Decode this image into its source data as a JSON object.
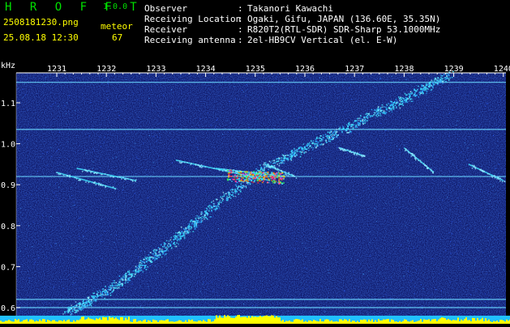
{
  "app": {
    "name": "H R O F F T",
    "version": "1.0.0"
  },
  "file": {
    "name": "2508181230.png",
    "datetime": "25.08.18 12:30",
    "meteor_label": "meteor",
    "meteor_count": "67"
  },
  "meta": [
    {
      "label": "Observer",
      "value": "Takanori Kawachi"
    },
    {
      "label": "Receiving Location",
      "value": "Ogaki, Gifu, JAPAN (136.60E, 35.35N)"
    },
    {
      "label": "Receiver",
      "value": "R820T2(RTL-SDR) SDR-Sharp 53.1000MHz"
    },
    {
      "label": "Receiving antenna",
      "value": "2el-HB9CV Vertical (el. E-W)"
    }
  ],
  "colors": {
    "background": "#000000",
    "plot_bg": "#101a6a",
    "title_green": "#00e000",
    "file_yellow": "#ffff00",
    "tick_yellow": "#ffff00",
    "echo_cyan": "#40e0ff",
    "echo_hot": "#ff40c0",
    "noise_bar": "#ffff00",
    "baseline": "#20c0ff"
  },
  "chart_data": {
    "type": "heatmap",
    "y_unit_label": "kHz",
    "x_ticks": [
      "1231",
      "1232",
      "1233",
      "1234",
      "1235",
      "1236",
      "1237",
      "1238",
      "1239",
      "1240"
    ],
    "y_ticks": [
      "1.1",
      "1.0",
      "0.9",
      "0.8",
      "0.7",
      "0.6"
    ],
    "ylim": [
      0.58,
      1.18
    ],
    "xlim": [
      1230.6,
      1240.2
    ],
    "horizontal_lines_khz": [
      1.15,
      1.035,
      0.92,
      0.62,
      0.6
    ],
    "main_trace": [
      {
        "t": 1231.2,
        "f": 0.59
      },
      {
        "t": 1232.0,
        "f": 0.64
      },
      {
        "t": 1233.0,
        "f": 0.73
      },
      {
        "t": 1234.0,
        "f": 0.83
      },
      {
        "t": 1235.0,
        "f": 0.93
      },
      {
        "t": 1236.0,
        "f": 0.99
      },
      {
        "t": 1237.0,
        "f": 1.05
      },
      {
        "t": 1238.0,
        "f": 1.11
      },
      {
        "t": 1238.9,
        "f": 1.17
      }
    ],
    "meteor_echoes": [
      {
        "t0": 1231.0,
        "f0": 0.93,
        "t1": 1232.2,
        "f1": 0.89
      },
      {
        "t0": 1231.4,
        "f0": 0.94,
        "t1": 1232.6,
        "f1": 0.91
      },
      {
        "t0": 1233.4,
        "f0": 0.96,
        "t1": 1235.3,
        "f1": 0.91
      },
      {
        "t0": 1234.2,
        "f0": 0.94,
        "t1": 1235.6,
        "f1": 0.92
      },
      {
        "t0": 1235.2,
        "f0": 0.95,
        "t1": 1235.8,
        "f1": 0.92
      },
      {
        "t0": 1236.7,
        "f0": 0.99,
        "t1": 1237.2,
        "f1": 0.97
      },
      {
        "t0": 1238.0,
        "f0": 0.99,
        "t1": 1238.6,
        "f1": 0.93
      },
      {
        "t0": 1239.3,
        "f0": 0.95,
        "t1": 1240.0,
        "f1": 0.91
      }
    ]
  }
}
